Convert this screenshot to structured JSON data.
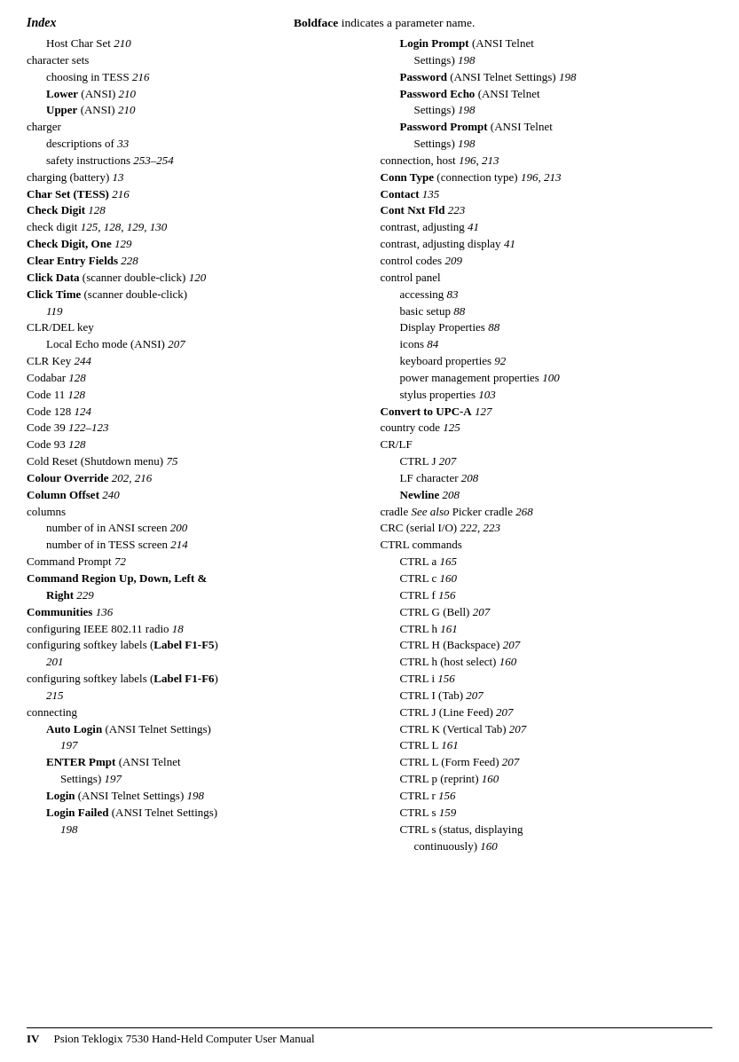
{
  "header": {
    "left": "Index",
    "center_pre": "",
    "center_bold": "Boldface",
    "center_post": " indicates a parameter name."
  },
  "footer": {
    "page": "IV",
    "text": "Psion Teklogix 7530 Hand-Held Computer User Manual"
  },
  "col1": [
    {
      "type": "indent1",
      "text": "Host Char Set   ",
      "italic": "210"
    },
    {
      "type": "normal",
      "text": "character sets"
    },
    {
      "type": "indent1",
      "text": "choosing in TESS   ",
      "italic": "216"
    },
    {
      "type": "indent1",
      "bold": "Lower",
      "text": " (ANSI)   ",
      "italic": "210"
    },
    {
      "type": "indent1",
      "bold": "Upper",
      "text": " (ANSI)   ",
      "italic": "210"
    },
    {
      "type": "normal",
      "text": "charger"
    },
    {
      "type": "indent1",
      "text": "descriptions of   ",
      "italic": "33"
    },
    {
      "type": "indent1",
      "text": "safety instructions   ",
      "italic": "253–254"
    },
    {
      "type": "normal",
      "text": "charging (battery)   ",
      "italic": "13"
    },
    {
      "type": "normal",
      "bold": "Char Set (TESS)",
      "text": "   ",
      "italic": "216"
    },
    {
      "type": "normal",
      "bold": "Check Digit",
      "text": "   ",
      "italic": "128"
    },
    {
      "type": "normal",
      "text": "check digit   ",
      "italic": "125, 128, 129, 130"
    },
    {
      "type": "normal",
      "bold": "Check Digit, One",
      "text": "   ",
      "italic": "129"
    },
    {
      "type": "normal",
      "bold": "Clear Entry Fields",
      "text": "   ",
      "italic": "228"
    },
    {
      "type": "normal",
      "bold": "Click Data",
      "text": " (scanner double-click)   ",
      "italic": "120"
    },
    {
      "type": "normal",
      "bold": "Click Time",
      "text": " (scanner double-click)"
    },
    {
      "type": "indent1",
      "italic": "119"
    },
    {
      "type": "normal",
      "text": "CLR/DEL key"
    },
    {
      "type": "indent1",
      "text": "Local Echo mode (ANSI)   ",
      "italic": "207"
    },
    {
      "type": "normal",
      "text": "CLR Key   ",
      "italic": "244"
    },
    {
      "type": "normal",
      "text": "Codabar   ",
      "italic": "128"
    },
    {
      "type": "normal",
      "text": "Code 11   ",
      "italic": "128"
    },
    {
      "type": "normal",
      "text": "Code 128   ",
      "italic": "124"
    },
    {
      "type": "normal",
      "text": "Code 39   ",
      "italic": "122–123"
    },
    {
      "type": "normal",
      "text": "Code 93   ",
      "italic": "128"
    },
    {
      "type": "normal",
      "text": "Cold Reset (Shutdown menu)   ",
      "italic": "75"
    },
    {
      "type": "normal",
      "bold": "Colour Override",
      "text": "   ",
      "italic": "202, 216"
    },
    {
      "type": "normal",
      "bold": "Column Offset",
      "text": "   ",
      "italic": "240"
    },
    {
      "type": "normal",
      "text": "columns"
    },
    {
      "type": "indent1",
      "text": "number of in ANSI screen   ",
      "italic": "200"
    },
    {
      "type": "indent1",
      "text": "number of in TESS screen   ",
      "italic": "214"
    },
    {
      "type": "normal",
      "text": "Command Prompt   ",
      "italic": "72"
    },
    {
      "type": "normal",
      "bold": "Command Region Up, Down, Left &"
    },
    {
      "type": "indent1",
      "bold": "Right",
      "text": "   ",
      "italic": "229"
    },
    {
      "type": "normal",
      "bold": "Communities",
      "text": "   ",
      "italic": "136"
    },
    {
      "type": "normal",
      "text": "configuring IEEE 802.11 radio   ",
      "italic": "18"
    },
    {
      "type": "normal",
      "text": "configuring softkey labels (",
      "bold": "Label F1-F5",
      "text2": ") "
    },
    {
      "type": "indent1",
      "italic": "201"
    },
    {
      "type": "normal",
      "text": "configuring softkey labels (",
      "bold": "Label F1-F6",
      "text2": ")"
    },
    {
      "type": "indent1",
      "italic": "215"
    },
    {
      "type": "normal",
      "text": "connecting"
    },
    {
      "type": "indent1",
      "bold": "Auto Login",
      "text": " (ANSI Telnet Settings)"
    },
    {
      "type": "indent2",
      "italic": "197"
    },
    {
      "type": "indent1",
      "bold": "ENTER Pmpt",
      "text": " (ANSI Telnet"
    },
    {
      "type": "indent2",
      "text": "Settings)   ",
      "italic": "197"
    },
    {
      "type": "indent1",
      "bold": "Login",
      "text": " (ANSI Telnet Settings)   ",
      "italic": "198"
    },
    {
      "type": "indent1",
      "bold": "Login Failed",
      "text": " (ANSI Telnet Settings)"
    },
    {
      "type": "indent2",
      "italic": "198"
    }
  ],
  "col2": [
    {
      "type": "indent1",
      "bold": "Login Prompt",
      "text": " (ANSI Telnet"
    },
    {
      "type": "indent2",
      "text": "Settings)   ",
      "italic": "198"
    },
    {
      "type": "indent1",
      "bold": "Password",
      "text": " (ANSI Telnet Settings)   ",
      "italic": "198"
    },
    {
      "type": "indent1",
      "bold": "Password Echo",
      "text": " (ANSI Telnet"
    },
    {
      "type": "indent2",
      "text": "Settings)   ",
      "italic": "198"
    },
    {
      "type": "indent1",
      "bold": "Password Prompt",
      "text": " (ANSI Telnet"
    },
    {
      "type": "indent2",
      "text": "Settings)   ",
      "italic": "198"
    },
    {
      "type": "normal",
      "text": "connection, host   ",
      "italic": "196, 213"
    },
    {
      "type": "normal",
      "bold": "Conn Type",
      "text": " (connection type)   ",
      "italic": "196, 213"
    },
    {
      "type": "normal",
      "bold": "Contact",
      "text": "   ",
      "italic": "135"
    },
    {
      "type": "normal",
      "bold": "Cont Nxt Fld",
      "text": "   ",
      "italic": "223"
    },
    {
      "type": "normal",
      "text": "contrast, adjusting   ",
      "italic": "41"
    },
    {
      "type": "normal",
      "text": "contrast, adjusting display   ",
      "italic": "41"
    },
    {
      "type": "normal",
      "text": "control codes   ",
      "italic": "209"
    },
    {
      "type": "normal",
      "text": "control panel"
    },
    {
      "type": "indent1",
      "text": "accessing   ",
      "italic": "83"
    },
    {
      "type": "indent1",
      "text": "basic setup   ",
      "italic": "88"
    },
    {
      "type": "indent1",
      "text": "Display Properties   ",
      "italic": "88"
    },
    {
      "type": "indent1",
      "text": "icons   ",
      "italic": "84"
    },
    {
      "type": "indent1",
      "text": "keyboard properties   ",
      "italic": "92"
    },
    {
      "type": "indent1",
      "text": "power management properties   ",
      "italic": "100"
    },
    {
      "type": "indent1",
      "text": "stylus properties   ",
      "italic": "103"
    },
    {
      "type": "normal",
      "bold": "Convert to UPC-A",
      "text": "   ",
      "italic": "127"
    },
    {
      "type": "normal",
      "text": "country code   ",
      "italic": "125"
    },
    {
      "type": "normal",
      "text": "CR/LF"
    },
    {
      "type": "indent1",
      "text": "CTRL J   ",
      "italic": "207"
    },
    {
      "type": "indent1",
      "text": "LF character   ",
      "italic": "208"
    },
    {
      "type": "indent1",
      "bold": "Newline",
      "text": "   ",
      "italic": "208"
    },
    {
      "type": "normal",
      "text": "cradle ",
      "italic_see": "See also",
      "text2": " Picker cradle   ",
      "italic": "268"
    },
    {
      "type": "normal",
      "text": "CRC (serial I/O)   ",
      "italic": "222, 223"
    },
    {
      "type": "normal",
      "text": "CTRL commands"
    },
    {
      "type": "indent1",
      "text": "CTRL a   ",
      "italic": "165"
    },
    {
      "type": "indent1",
      "text": "CTRL c   ",
      "italic": "160"
    },
    {
      "type": "indent1",
      "text": "CTRL f   ",
      "italic": "156"
    },
    {
      "type": "indent1",
      "text": "CTRL G (Bell)   ",
      "italic": "207"
    },
    {
      "type": "indent1",
      "text": "CTRL h   ",
      "italic": "161"
    },
    {
      "type": "indent1",
      "text": "CTRL H (Backspace)   ",
      "italic": "207"
    },
    {
      "type": "indent1",
      "text": "CTRL h (host select)   ",
      "italic": "160"
    },
    {
      "type": "indent1",
      "text": "CTRL i   ",
      "italic": "156"
    },
    {
      "type": "indent1",
      "text": "CTRL I (Tab)   ",
      "italic": "207"
    },
    {
      "type": "indent1",
      "text": "CTRL J (Line Feed)   ",
      "italic": "207"
    },
    {
      "type": "indent1",
      "text": "CTRL K (Vertical Tab)   ",
      "italic": "207"
    },
    {
      "type": "indent1",
      "text": "CTRL L   ",
      "italic": "161"
    },
    {
      "type": "indent1",
      "text": "CTRL L (Form Feed)   ",
      "italic": "207"
    },
    {
      "type": "indent1",
      "text": "CTRL p (reprint)   ",
      "italic": "160"
    },
    {
      "type": "indent1",
      "text": "CTRL r   ",
      "italic": "156"
    },
    {
      "type": "indent1",
      "text": "CTRL s   ",
      "italic": "159"
    },
    {
      "type": "indent1",
      "text": "CTRL s (status, displaying"
    },
    {
      "type": "indent2",
      "text": "continuously)   ",
      "italic": "160"
    }
  ]
}
